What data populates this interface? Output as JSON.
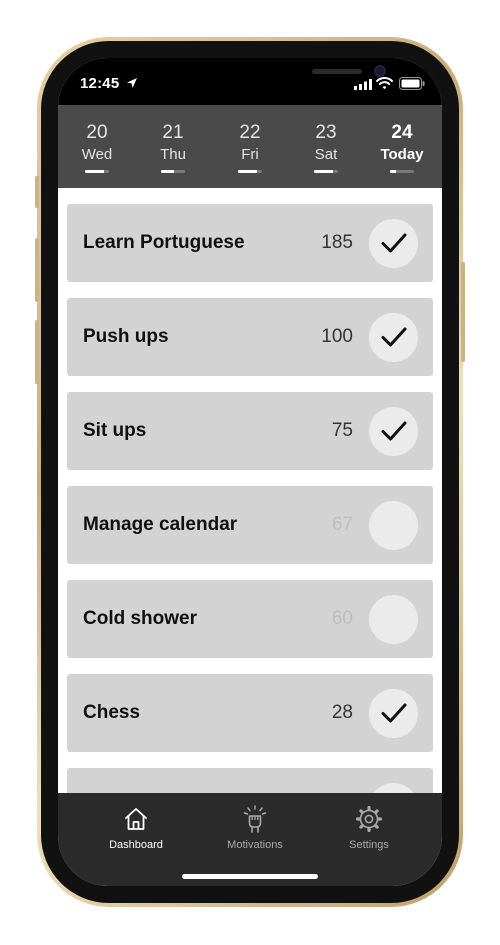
{
  "status_bar": {
    "time": "12:45",
    "icons": [
      "location-arrow-icon",
      "signal-icon",
      "wifi-icon",
      "battery-icon"
    ]
  },
  "days": [
    {
      "number": "20",
      "label": "Wed",
      "progress": 0.8,
      "is_today": false
    },
    {
      "number": "21",
      "label": "Thu",
      "progress": 0.55,
      "is_today": false
    },
    {
      "number": "22",
      "label": "Fri",
      "progress": 0.8,
      "is_today": false
    },
    {
      "number": "23",
      "label": "Sat",
      "progress": 0.8,
      "is_today": false
    },
    {
      "number": "24",
      "label": "Today",
      "progress": 0.25,
      "is_today": true
    }
  ],
  "habits": [
    {
      "name": "Learn Portuguese",
      "count": "185",
      "done": true
    },
    {
      "name": "Push ups",
      "count": "100",
      "done": true
    },
    {
      "name": "Sit ups",
      "count": "75",
      "done": true
    },
    {
      "name": "Manage calendar",
      "count": "67",
      "done": false
    },
    {
      "name": "Cold shower",
      "count": "60",
      "done": false
    },
    {
      "name": "Chess",
      "count": "28",
      "done": true
    }
  ],
  "tabs": [
    {
      "label": "Dashboard",
      "icon": "home-icon",
      "active": true
    },
    {
      "label": "Motivations",
      "icon": "raised-fist-icon",
      "active": false
    },
    {
      "label": "Settings",
      "icon": "gear-icon",
      "active": false
    }
  ],
  "colors": {
    "header_background": "#4a4a4a",
    "row_background": "#d3d3d3",
    "tab_bar_background": "#2b2b2b",
    "check_circle": "#ebebeb"
  }
}
